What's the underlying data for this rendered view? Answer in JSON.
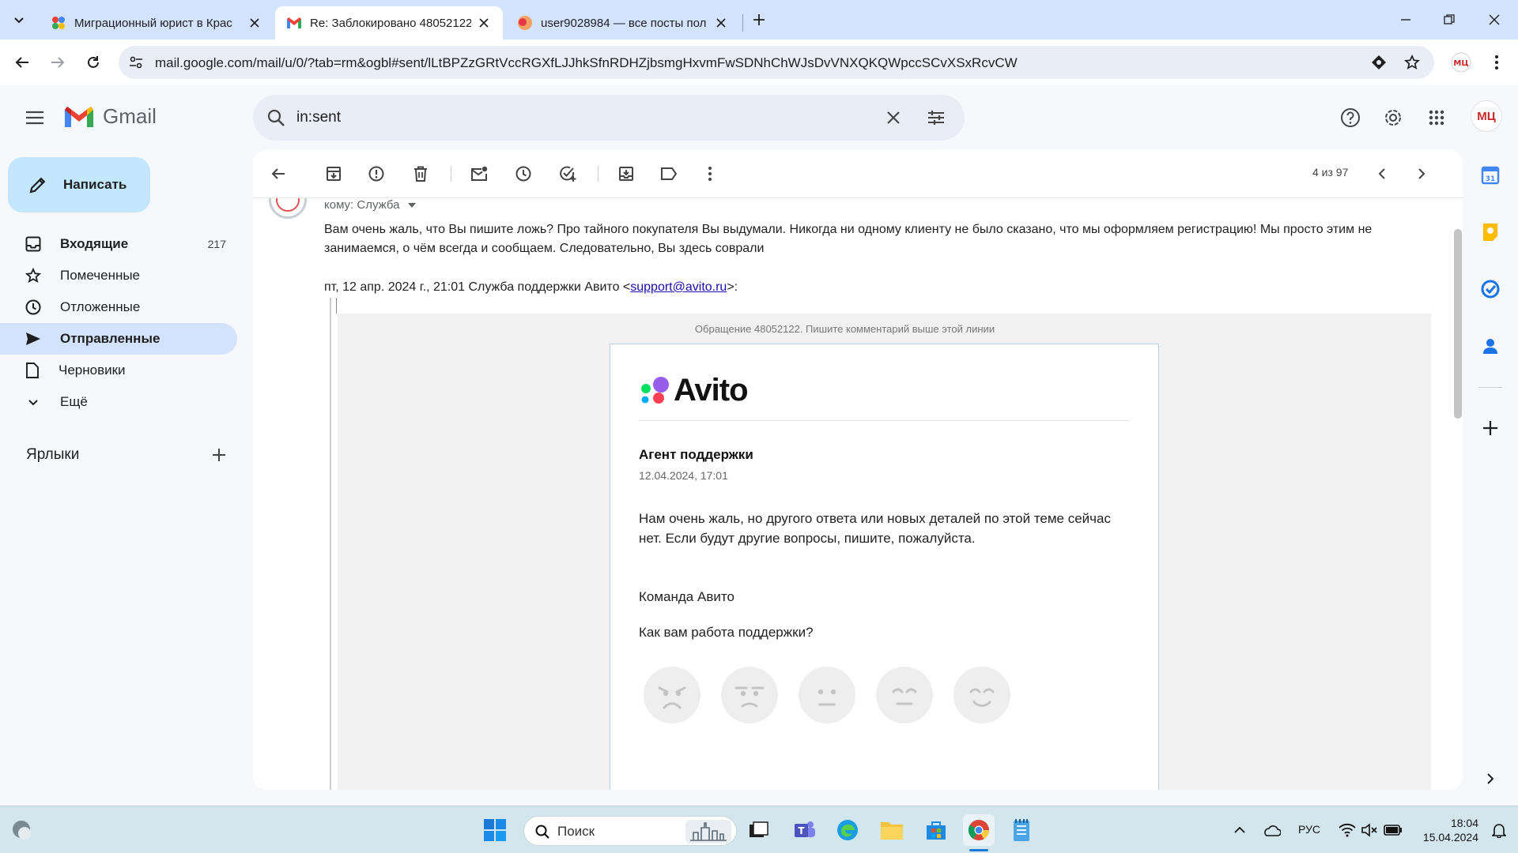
{
  "browser": {
    "tabs": [
      {
        "title": "Миграционный юрист в Крас"
      },
      {
        "title": "Re: Заблокировано 48052122"
      },
      {
        "title": "user9028984 — все посты пол"
      }
    ],
    "url": "mail.google.com/mail/u/0/?tab=rm&ogbl#sent/lLtBPZzGRtVccRGXfLJJhkSfnRDHZjbsmgHxvmFwSDNhChWJsDvVNXQKQWpccSCvXSxRcvCW"
  },
  "gmail": {
    "logo": "Gmail",
    "search_value": "in:sent",
    "compose": "Написать",
    "nav": [
      {
        "label": "Входящие",
        "count": "217"
      },
      {
        "label": "Помеченные"
      },
      {
        "label": "Отложенные"
      },
      {
        "label": "Отправленные"
      },
      {
        "label": "Черновики"
      },
      {
        "label": "Ещё"
      }
    ],
    "labels_title": "Ярлыки",
    "avatar": "МЦ",
    "pager": "4 из 97"
  },
  "message": {
    "recipients": "кому: Служба",
    "body": "Вам очень жаль, что Вы пишите ложь? Про тайного покупателя Вы выдумали. Никогда ни одному клиенту не было сказано, что мы оформляем регистрацию! Мы просто этим не занимаемся, о чём всегда и сообщаем. Следовательно, Вы здесь соврали",
    "quote_prefix": "пт, 12 апр. 2024 г., 21:01 Служба поддержки Авито <",
    "quote_email": "support@avito.ru",
    "quote_suffix": ">:",
    "marker": "Обращение 48052122. Пишите комментарий выше этой линии",
    "card": {
      "logo_text": "Avito",
      "agent": "Агент поддержки",
      "date": "12.04.2024, 17:01",
      "reply": "Нам очень жаль, но другого ответа или новых деталей по этой теме сейчас нет. Если будут другие вопросы, пишите, пожалуйста.",
      "team": "Команда Авито",
      "question": "Как вам работа поддержки?"
    }
  },
  "taskbar": {
    "search": "Поиск",
    "lang": "РУС",
    "time": "18:04",
    "date": "15.04.2024"
  }
}
